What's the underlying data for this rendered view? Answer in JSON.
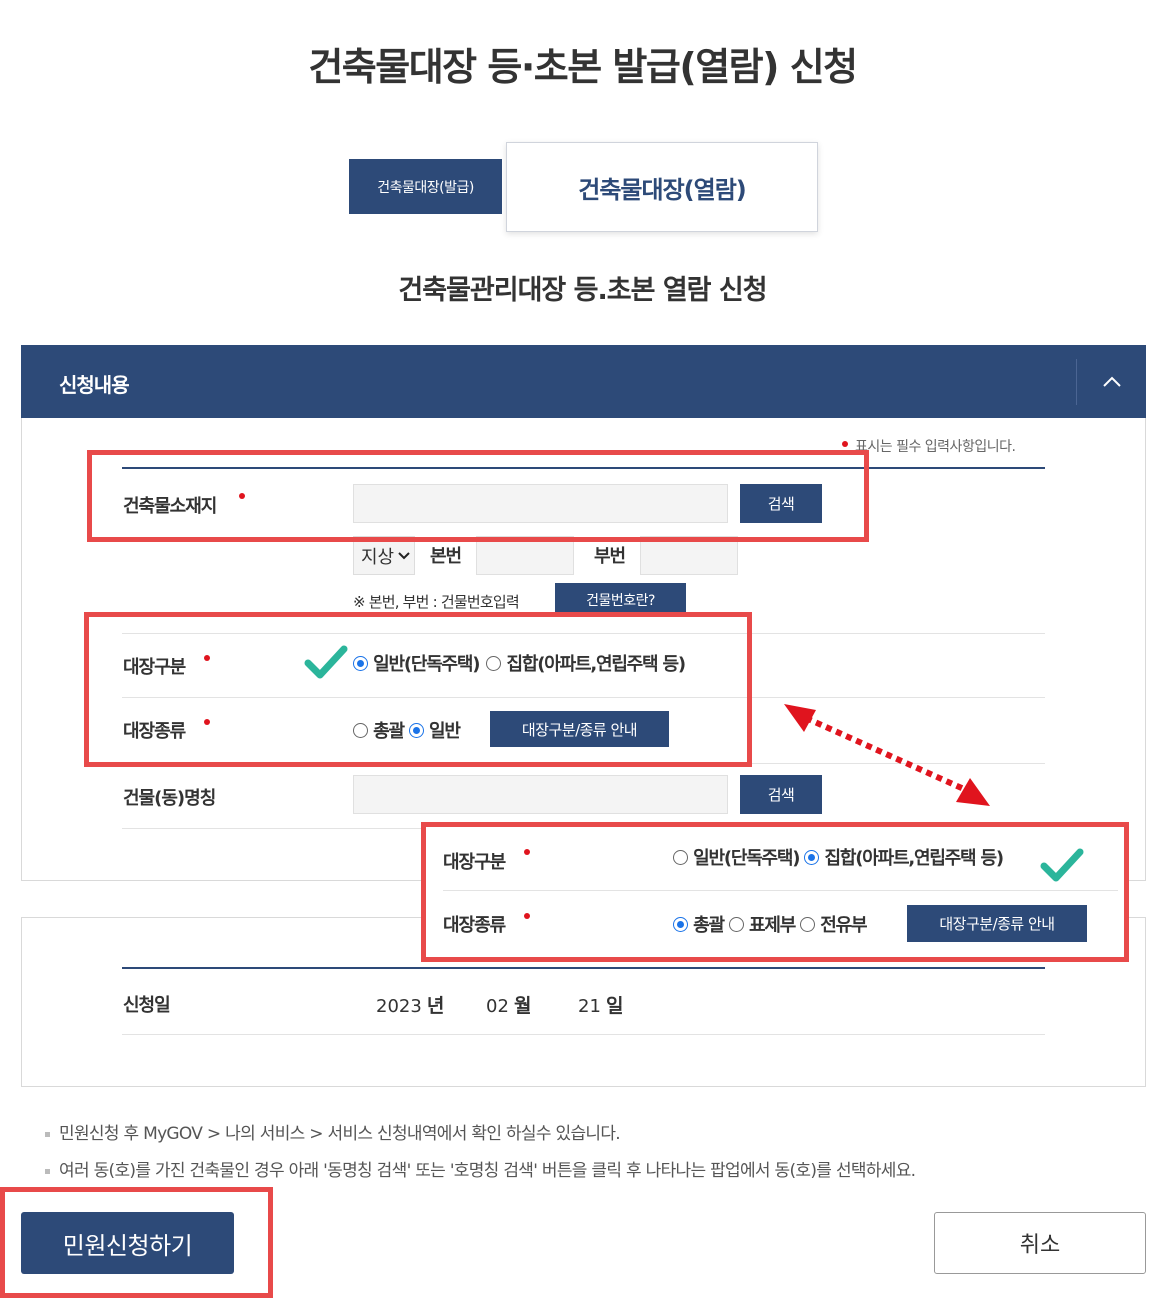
{
  "page_title": "건축물대장 등·초본 발급(열람) 신청",
  "tabs": [
    {
      "label": "건축물대장(발급)"
    },
    {
      "label": "건축물대장(열람)"
    }
  ],
  "sub_title": "건축물관리대장 등.초본 열람 신청",
  "section": {
    "title": "신청내용",
    "required_note": "표시는 필수 입력사항입니다."
  },
  "form": {
    "location_label": "건축물소재지",
    "search_button": "검색",
    "land_type": "지상",
    "main_no_label": "본번",
    "sub_no_label": "부번",
    "hint": "※ 본번, 부번 : 건물번호입력",
    "building_no_button": "건물번호란?",
    "ledger_class_label": "대장구분",
    "ledger_class_options": [
      "일반(단독주택)",
      "집합(아파트,연립주택 등)"
    ],
    "ledger_type_label": "대장종류",
    "ledger_type_options": [
      "총괄",
      "일반"
    ],
    "guide_button": "대장구분/종류 안내",
    "building_name_label": "건물(동)명칭",
    "search_button2": "검색"
  },
  "overlay": {
    "ledger_class_label": "대장구분",
    "ledger_class_options": [
      "일반(단독주택)",
      "집합(아파트,연립주택 등)"
    ],
    "ledger_type_label": "대장종류",
    "ledger_type_options": [
      "총괄",
      "표제부",
      "전유부"
    ],
    "guide_button": "대장구분/종류 안내"
  },
  "date": {
    "label": "신청일",
    "year": "2023",
    "year_unit": "년",
    "month": "02",
    "month_unit": "월",
    "day": "21",
    "day_unit": "일"
  },
  "notes": [
    "민원신청 후 MyGOV > 나의 서비스 > 서비스 신청내역에서 확인 하실수 있습니다.",
    "여러 동(호)를 가진 건축물인 경우 아래 '동명칭 검색' 또는 '호명칭 검색' 버튼을 클릭 후 나타나는 팝업에서 동(호)를 선택하세요."
  ],
  "buttons": {
    "submit": "민원신청하기",
    "cancel": "취소"
  },
  "colors": {
    "navy": "#2d4a78",
    "highlight_red": "#e84a4a",
    "check_green": "#2bb59b",
    "required_dot": "#e0141e",
    "radio_blue": "#1a73e8"
  },
  "icons": [
    "chevron-up-icon",
    "chevron-down-icon",
    "checkmark-icon",
    "double-arrow-icon"
  ]
}
